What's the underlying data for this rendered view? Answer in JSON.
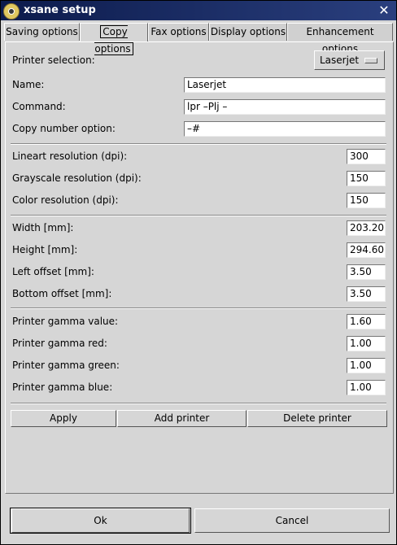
{
  "window": {
    "title": "xsane setup"
  },
  "tabs": [
    {
      "label": "Saving options"
    },
    {
      "label": "Copy options"
    },
    {
      "label": "Fax options"
    },
    {
      "label": "Display options"
    },
    {
      "label": "Enhancement options"
    }
  ],
  "printer": {
    "selection_label": "Printer selection:",
    "selection_value": "Laserjet",
    "name_label": "Name:",
    "name_value": "Laserjet",
    "command_label": "Command:",
    "command_value": "lpr –Plj –",
    "copy_number_label": "Copy number option:",
    "copy_number_value": "–#"
  },
  "resolution": {
    "lineart_label": "Lineart resolution (dpi):",
    "lineart_value": "300",
    "grayscale_label": "Grayscale resolution (dpi):",
    "grayscale_value": "150",
    "color_label": "Color resolution (dpi):",
    "color_value": "150"
  },
  "geometry": {
    "width_label": "Width [mm]:",
    "width_value": "203.20",
    "height_label": "Height [mm]:",
    "height_value": "294.60",
    "left_offset_label": "Left offset [mm]:",
    "left_offset_value": "3.50",
    "bottom_offset_label": "Bottom offset [mm]:",
    "bottom_offset_value": "3.50"
  },
  "gamma": {
    "value_label": "Printer gamma value:",
    "value_value": "1.60",
    "red_label": "Printer gamma red:",
    "red_value": "1.00",
    "green_label": "Printer gamma green:",
    "green_value": "1.00",
    "blue_label": "Printer gamma blue:",
    "blue_value": "1.00"
  },
  "actions": {
    "apply": "Apply",
    "add_printer": "Add printer",
    "delete_printer": "Delete printer"
  },
  "dialog": {
    "ok": "Ok",
    "cancel": "Cancel"
  }
}
